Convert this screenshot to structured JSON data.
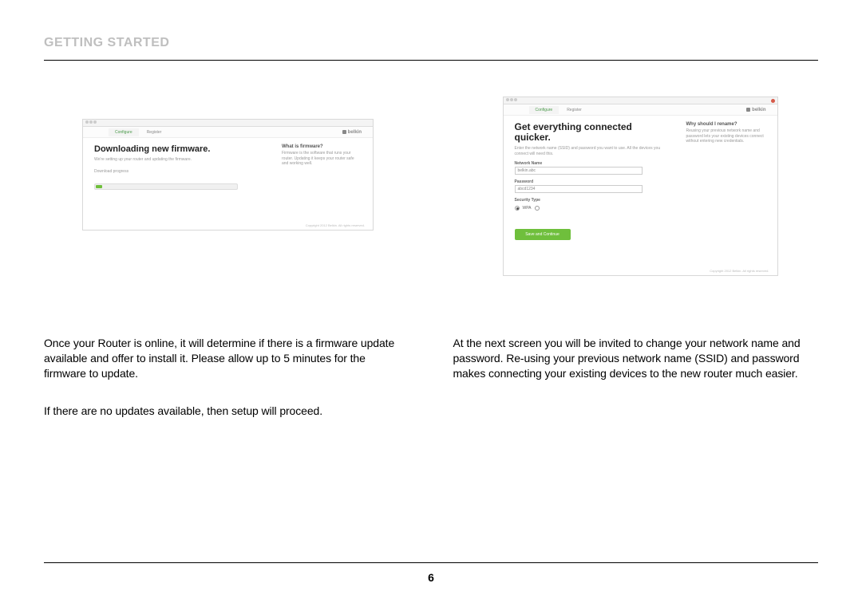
{
  "section_title": "GETTING STARTED",
  "page_number": "6",
  "left": {
    "browser_tabs": [
      "",
      "Configure",
      "Register"
    ],
    "brand": "belkin",
    "heading": "Downloading new firmware.",
    "sub": "We're setting up your router and updating the firmware.",
    "progress_label": "Download progress",
    "side_title": "What is firmware?",
    "side_text": "Firmware is the software that runs your router. Updating it keeps your router safe and working well.",
    "footer": "Copyright 2012 Belkin. All rights reserved.",
    "para1": "Once your Router is online, it will determine if there is a firmware update available and offer to install it. Please allow up to 5 minutes for the firmware to update.",
    "para2": "If there are no updates available, then setup will proceed."
  },
  "right": {
    "browser_tabs": [
      "",
      "Configure",
      "Register"
    ],
    "brand": "belkin",
    "heading": "Get everything connected quicker.",
    "sub": "Enter the network name (SSID) and password you want to use. All the devices you connect will need this.",
    "field_network_label": "Network Name",
    "field_network_value": "belkin.abc",
    "field_password_label": "Password",
    "field_password_value": "abcd1234",
    "field_security_label": "Security Type",
    "opt1": "WPA",
    "button": "Save and Continue",
    "side_title": "Why should I rename?",
    "side_text": "Reusing your previous network name and password lets your existing devices connect without entering new credentials.",
    "footer": "Copyright 2012 Belkin. All rights reserved.",
    "para1": "At the next screen you will be invited to change your network name and password. Re-using your previous network name (SSID) and password makes connecting your existing devices to the new router much easier."
  }
}
